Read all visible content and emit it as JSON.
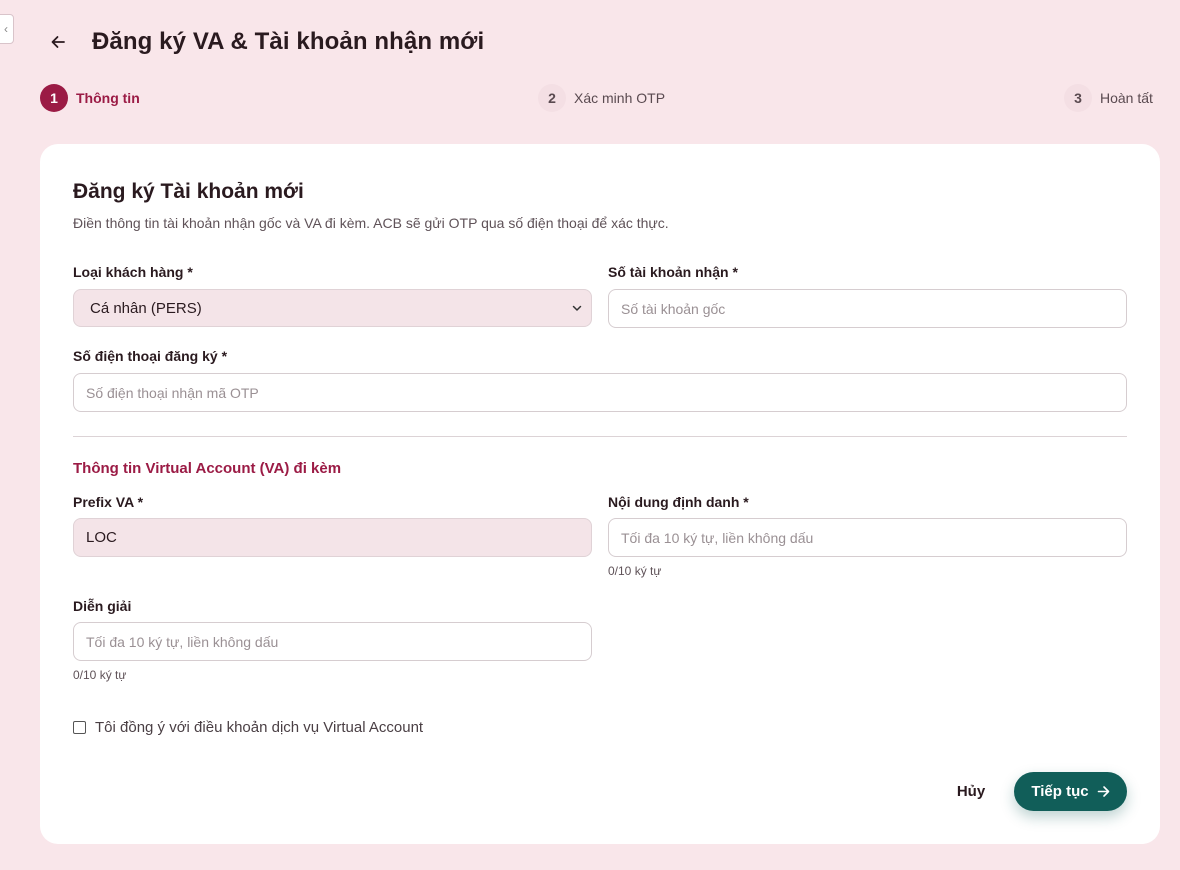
{
  "sidebar_toggle": {
    "icon": "chevron-left-icon",
    "glyph": "‹"
  },
  "header": {
    "title": "Đăng ký VA & Tài khoản nhận mới",
    "back_icon": "arrow-left-icon"
  },
  "stepper": {
    "steps": [
      {
        "number": "1",
        "label": "Thông tin",
        "active": true
      },
      {
        "number": "2",
        "label": "Xác minh OTP",
        "active": false
      },
      {
        "number": "3",
        "label": "Hoàn tất",
        "active": false
      }
    ]
  },
  "card": {
    "title": "Đăng ký Tài khoản mới",
    "description": "Điền thông tin tài khoản nhận gốc và VA đi kèm. ACB sẽ gửi OTP qua số điện thoại để xác thực."
  },
  "form": {
    "customer_type": {
      "label": "Loại khách hàng *",
      "value": "Cá nhân (PERS)"
    },
    "account_number": {
      "label": "Số tài khoản nhận *",
      "placeholder": "Số tài khoản gốc",
      "value": ""
    },
    "phone": {
      "label": "Số điện thoại đăng ký *",
      "placeholder": "Số điện thoại nhận mã OTP",
      "value": ""
    }
  },
  "va_section": {
    "title": "Thông tin Virtual Account (VA) đi kèm",
    "prefix": {
      "label": "Prefix VA *",
      "value": "LOC"
    },
    "identifier": {
      "label": "Nội dung định danh *",
      "placeholder": "Tối đa 10 ký tự, liền không dấu",
      "counter": "0/10 ký tự"
    },
    "description": {
      "label": "Diễn giải",
      "placeholder": "Tối đa 10 ký tự, liền không dấu",
      "counter": "0/10 ký tự"
    }
  },
  "agreement": {
    "label": "Tôi đồng ý với điều khoản dịch vụ Virtual Account",
    "checked": false
  },
  "actions": {
    "cancel_label": "Hủy",
    "next_label": "Tiếp tục",
    "next_icon": "arrow-right-icon"
  },
  "colors": {
    "background": "#f9e6ea",
    "accent": "#9b1b45",
    "primary_button": "#115e59",
    "readonly_fill": "#f4e4e8"
  }
}
